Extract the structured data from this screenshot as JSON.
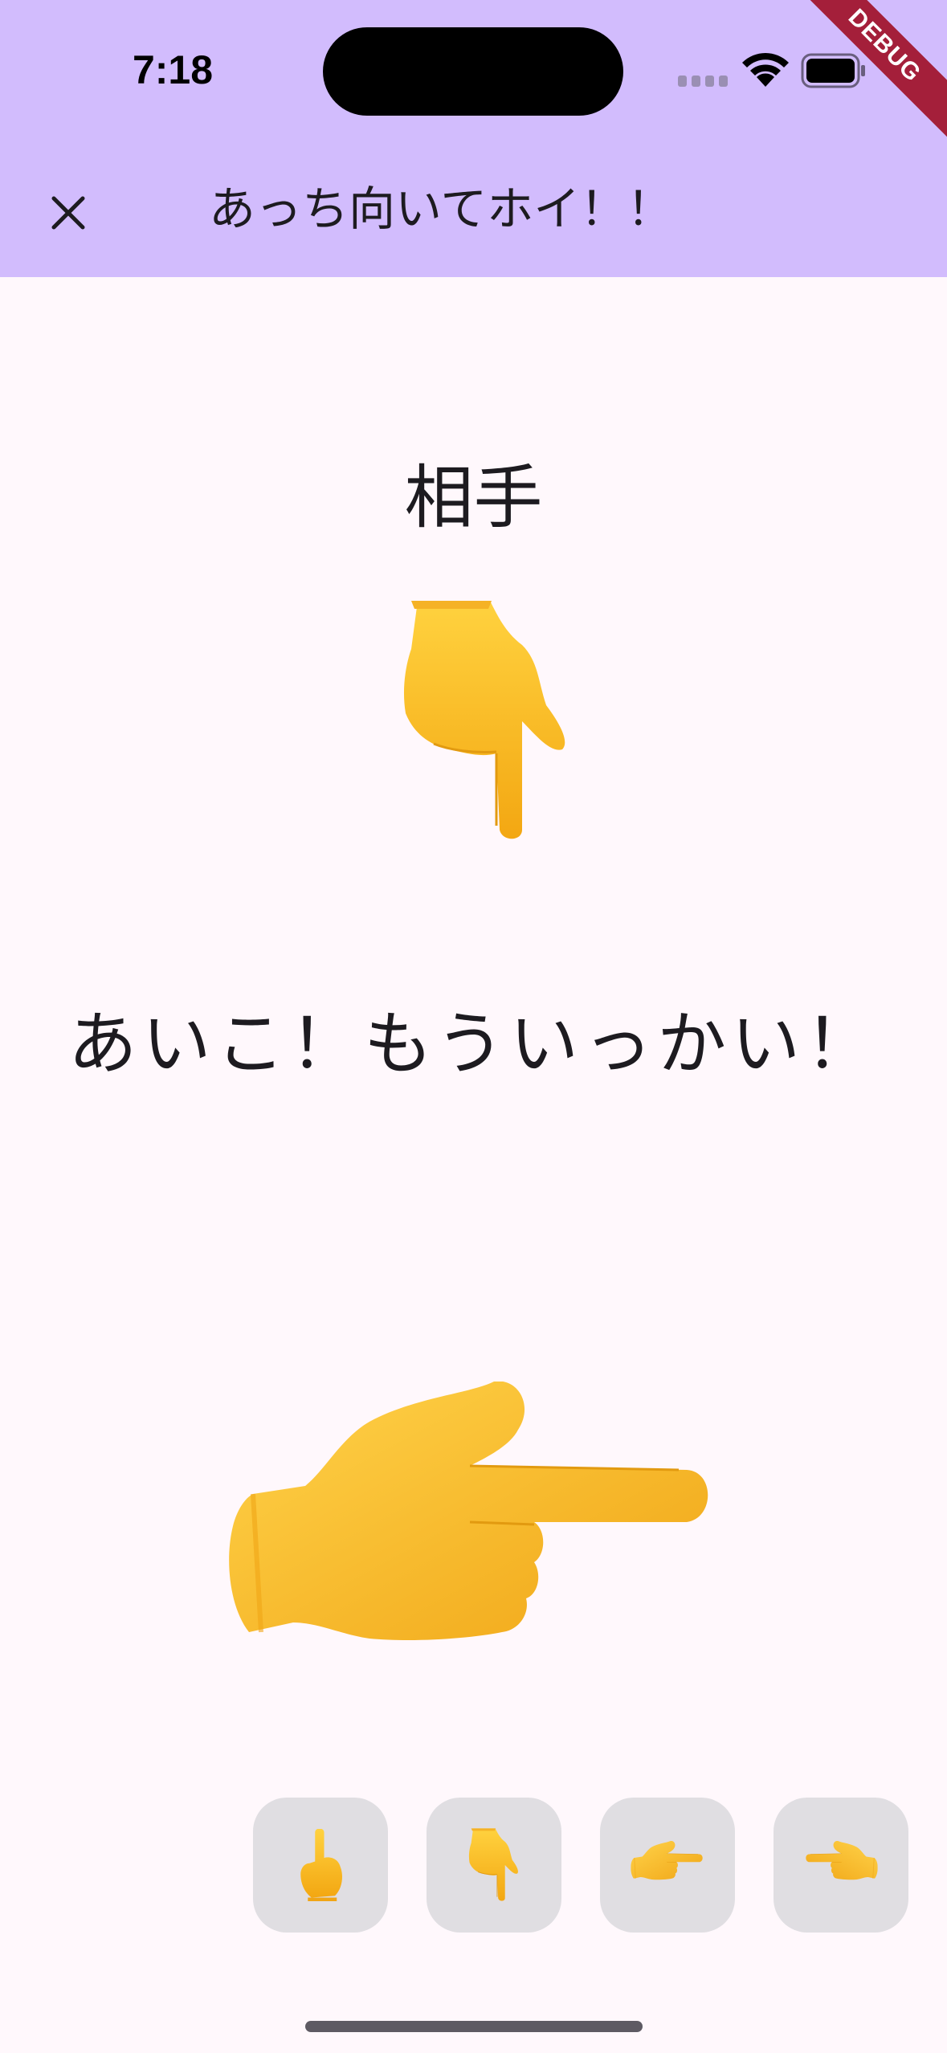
{
  "status_bar": {
    "time": "7:18"
  },
  "debug_banner": {
    "label": "DEBUG"
  },
  "app_bar": {
    "title": "あっち向いてホイ！！",
    "close_icon": "close-icon",
    "background": "#D2BCFD"
  },
  "opponent": {
    "label": "相手",
    "hand": "pointing-down"
  },
  "result": {
    "message": "あいこ！もういっかい！"
  },
  "player": {
    "hand": "pointing-right"
  },
  "choices": [
    {
      "direction": "up",
      "icon": "pointing-up-icon"
    },
    {
      "direction": "down",
      "icon": "pointing-down-icon"
    },
    {
      "direction": "right",
      "icon": "pointing-right-icon"
    },
    {
      "direction": "left",
      "icon": "pointing-left-icon"
    }
  ],
  "colors": {
    "background": "#FFF8FC",
    "button_bg": "#E0DEE2",
    "hand_yellow": "#FFC83D",
    "debug_red": "#A41F3A"
  }
}
